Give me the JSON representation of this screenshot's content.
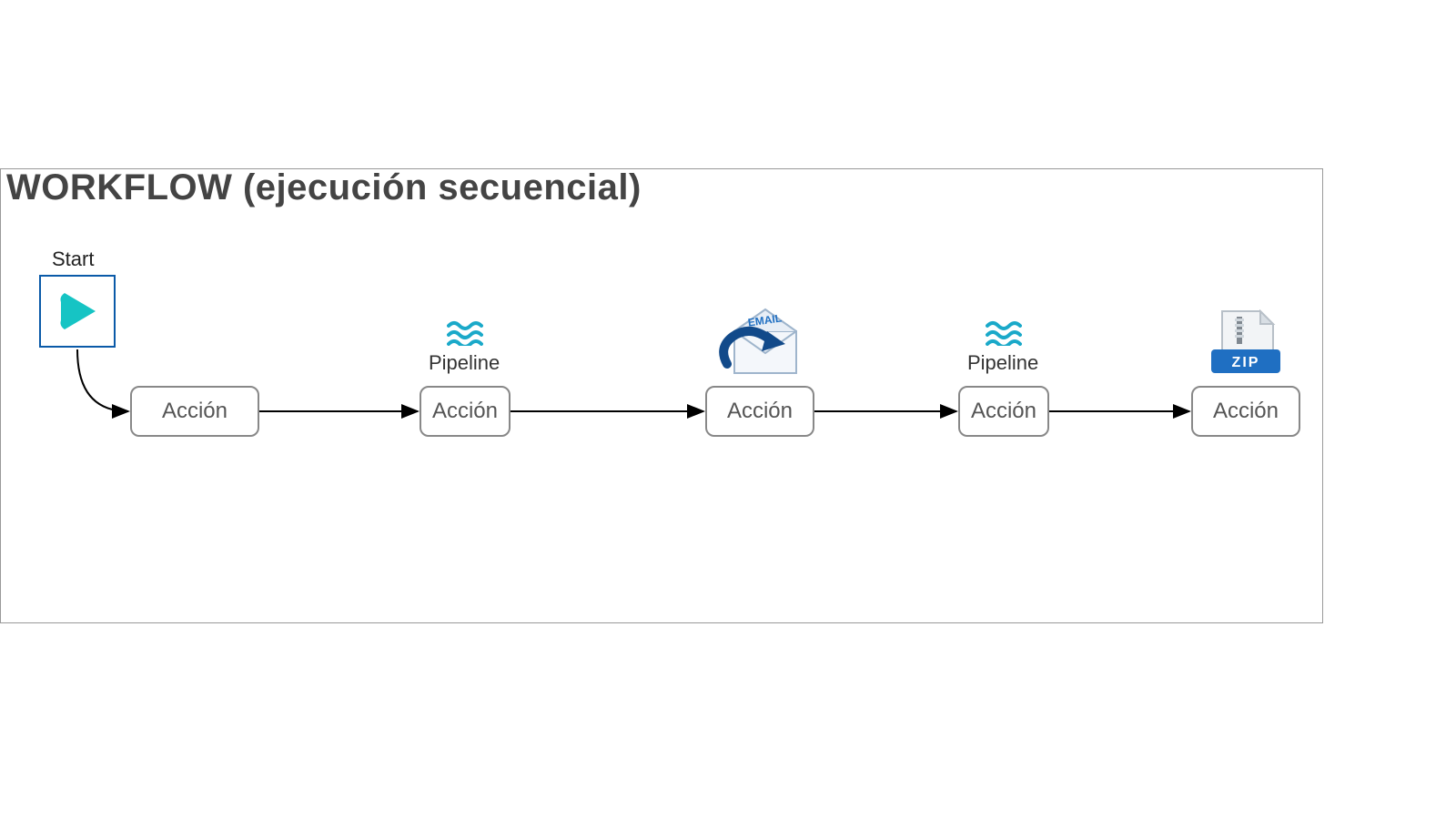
{
  "title": "WORKFLOW (ejecución secuencial)",
  "start_label": "Start",
  "nodes": {
    "n1": {
      "label": "Acción"
    },
    "n2": {
      "label": "Acción",
      "top_label": "Pipeline"
    },
    "n3": {
      "label": "Acción",
      "icon": "email"
    },
    "n4": {
      "label": "Acción",
      "top_label": "Pipeline"
    },
    "n5": {
      "label": "Acción",
      "icon": "zip"
    }
  },
  "icon_text": {
    "email": "EMAIL",
    "zip": "ZIP"
  }
}
